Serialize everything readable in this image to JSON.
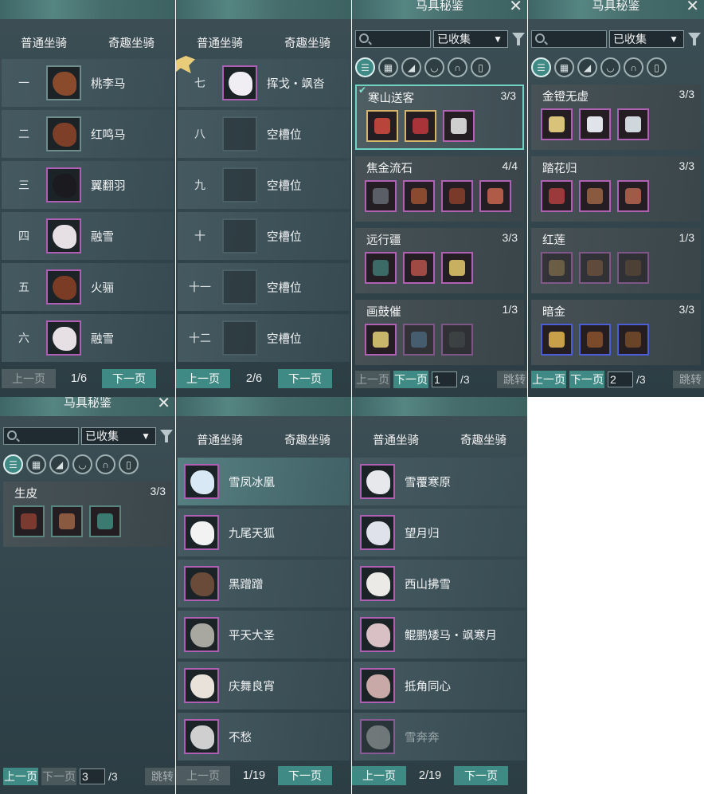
{
  "tabs": {
    "normal": "普通坐骑",
    "fun": "奇趣坐骑"
  },
  "pager": {
    "prev": "上一页",
    "next": "下一页"
  },
  "panel1": {
    "page": "1/6",
    "rows": [
      {
        "num": "一",
        "name": "桃李马"
      },
      {
        "num": "二",
        "name": "红鸣马"
      },
      {
        "num": "三",
        "name": "翼翻羽"
      },
      {
        "num": "四",
        "name": "融雪"
      },
      {
        "num": "五",
        "name": "火骊"
      },
      {
        "num": "六",
        "name": "融雪"
      }
    ]
  },
  "panel2": {
    "page": "2/6",
    "rows": [
      {
        "num": "七",
        "name": "挥戈・飒沓"
      },
      {
        "num": "八",
        "name": "空槽位"
      },
      {
        "num": "九",
        "name": "空槽位"
      },
      {
        "num": "十",
        "name": "空槽位"
      },
      {
        "num": "十一",
        "name": "空槽位"
      },
      {
        "num": "十二",
        "name": "空槽位"
      }
    ]
  },
  "codex": {
    "title": "马具秘鉴",
    "close": "✕",
    "filter_value": "已收集",
    "jump_label": "跳转",
    "total_pages": "/3"
  },
  "panel3": {
    "page_input": "1",
    "sets": [
      {
        "name": "寒山送客",
        "count": "3/3"
      },
      {
        "name": "焦金流石",
        "count": "4/4"
      },
      {
        "name": "远行疆",
        "count": "3/3"
      },
      {
        "name": "画鼓催",
        "count": "1/3"
      }
    ]
  },
  "panel4": {
    "page_input": "2",
    "sets": [
      {
        "name": "金镫无虚",
        "count": "3/3"
      },
      {
        "name": "踏花归",
        "count": "3/3"
      },
      {
        "name": "红莲",
        "count": "1/3"
      },
      {
        "name": "暗金",
        "count": "3/3"
      }
    ]
  },
  "panel5": {
    "page_input": "3",
    "sets": [
      {
        "name": "生皮",
        "count": "3/3"
      }
    ]
  },
  "panel6": {
    "page": "1/19",
    "rows": [
      {
        "name": "雪凤冰凰"
      },
      {
        "name": "九尾天狐"
      },
      {
        "name": "黑蹭蹭"
      },
      {
        "name": "平天大圣"
      },
      {
        "name": "庆舞良宵"
      },
      {
        "name": "不愁"
      }
    ]
  },
  "panel7": {
    "page": "2/19",
    "rows": [
      {
        "name": "雪覆寒原"
      },
      {
        "name": "望月归"
      },
      {
        "name": "西山拂雪"
      },
      {
        "name": "鲲鹏矮马・飒寒月"
      },
      {
        "name": "抵角同心"
      },
      {
        "name": "雪奔奔"
      }
    ]
  },
  "colors": {
    "accent": "#3f8a84",
    "rare_border": "#b05db4",
    "selected_border": "#6fd3c3"
  }
}
